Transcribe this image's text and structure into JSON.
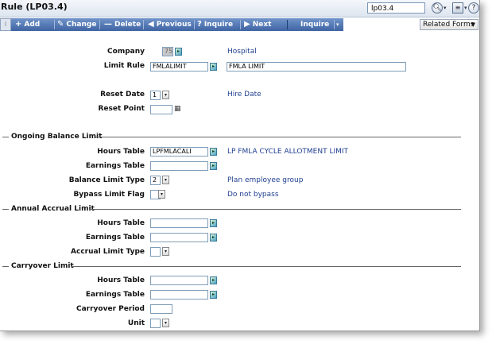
{
  "window": {
    "title": "Rule (LP03.4)",
    "token_input": "lp03.4",
    "icons": [
      "search-icon",
      "bookmark-icon",
      "help-icon"
    ]
  },
  "toolbar": {
    "add": "Add",
    "change": "Change",
    "delete": "Delete",
    "previous": "Previous",
    "inquire": "Inquire",
    "next": "Next",
    "inquire_menu": "Inquire",
    "related_forms": "Related Forms"
  },
  "colors": {
    "toolbar_blue": "#4a6fae",
    "description_text": "#1f3f8f"
  },
  "header": {
    "company_label": "Company",
    "company_value": "75",
    "company_desc": "Hospital",
    "limit_rule_label": "Limit Rule",
    "limit_rule_value": "FMLALIMIT",
    "limit_rule_desc": "FMLA LIMIT",
    "reset_date_label": "Reset Date",
    "reset_date_value": "1",
    "reset_date_desc": "Hire Date",
    "reset_point_label": "Reset Point",
    "reset_point_value": ""
  },
  "ongoing": {
    "title": "Ongoing Balance Limit",
    "hours_table_label": "Hours Table",
    "hours_table_value": "LPFMLACALI",
    "hours_table_desc": "LP FMLA CYCLE ALLOTMENT LIMIT",
    "earnings_table_label": "Earnings Table",
    "earnings_table_value": "",
    "balance_limit_type_label": "Balance Limit Type",
    "balance_limit_type_value": "2",
    "balance_limit_type_desc": "Plan employee group",
    "bypass_limit_flag_label": "Bypass Limit Flag",
    "bypass_limit_flag_value": "",
    "bypass_limit_flag_desc": "Do not bypass"
  },
  "annual": {
    "title": "Annual Accrual Limit",
    "hours_table_label": "Hours Table",
    "earnings_table_label": "Earnings Table",
    "accrual_limit_type_label": "Accrual Limit Type"
  },
  "carryover": {
    "title": "Carryover Limit",
    "hours_table_label": "Hours Table",
    "earnings_table_label": "Earnings Table",
    "carryover_period_label": "Carryover Period",
    "unit_label": "Unit"
  }
}
